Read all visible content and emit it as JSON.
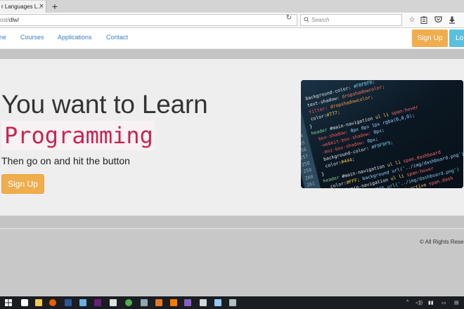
{
  "browser": {
    "tab_title": "r Languages L...",
    "tab_close": "×",
    "new_tab": "+",
    "url_prefix": "ost/",
    "url_path": "dlw/",
    "search_placeholder": "Search",
    "icons": [
      "star-icon",
      "clipboard-icon",
      "pocket-icon",
      "download-icon"
    ]
  },
  "nav": {
    "links": [
      "ne",
      "Courses",
      "Applications",
      "Contact"
    ],
    "signup": "Sign Up",
    "login": "Lo"
  },
  "hero": {
    "title": "You want to Learn",
    "code": "Programming",
    "subtitle": "Then go on and hit the button",
    "button": "Sign Up"
  },
  "footer": {
    "copyright": "© All Rights Reser"
  },
  "colors": {
    "warning": "#f0ad4e",
    "info": "#5bc0de",
    "link": "#3a7fc1",
    "code_text": "#c7254e",
    "code_bg": "#f9f2f4"
  },
  "taskbar": {
    "apps": [
      "windows-start",
      "edge",
      "store",
      "file-explorer",
      "firefox",
      "word",
      "visual-studio-code",
      "vs",
      "misc",
      "chrome",
      "app",
      "matlab",
      "vlc",
      "visual-studio",
      "app",
      "notepad",
      "app"
    ],
    "tray_icons": [
      "chevron-up-icon",
      "volume-icon",
      "network-icon",
      "battery-icon",
      "notification-icon"
    ]
  }
}
